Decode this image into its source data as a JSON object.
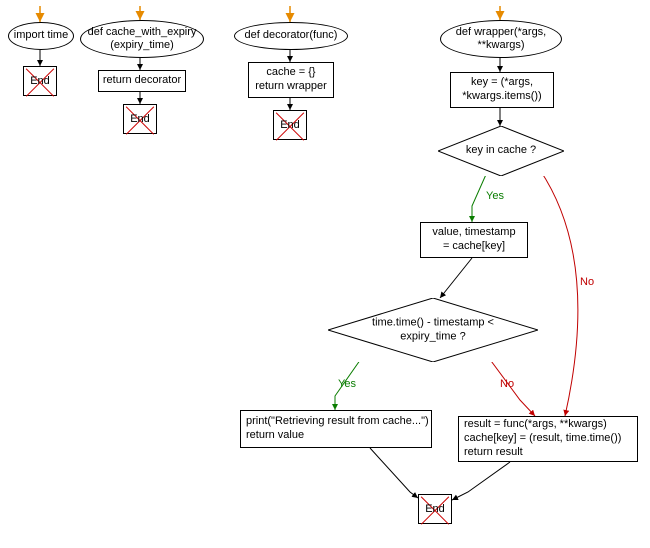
{
  "diagram": {
    "col1": {
      "start": "import time",
      "end": "End"
    },
    "col2": {
      "def": "def cache_with_expiry\n(expiry_time)",
      "ret": "return decorator",
      "end": "End"
    },
    "col3": {
      "def": "def decorator(func)",
      "body": "cache = {}\nreturn wrapper",
      "end": "End"
    },
    "col4": {
      "def": "def wrapper(*args,\n**kwargs)",
      "key": "key = (*args,\n*kwargs.items())",
      "cond1": "key in cache ?",
      "cacheHit": "value, timestamp\n= cache[key]",
      "cond2": "time.time() - timestamp <\nexpiry_time ?",
      "printRet": "print(\"Retrieving result from cache...\")\nreturn value",
      "miss": "result = func(*args, **kwargs)\ncache[key] = (result, time.time())\nreturn result",
      "end": "End"
    },
    "labels": {
      "yes": "Yes",
      "no": "No"
    }
  }
}
